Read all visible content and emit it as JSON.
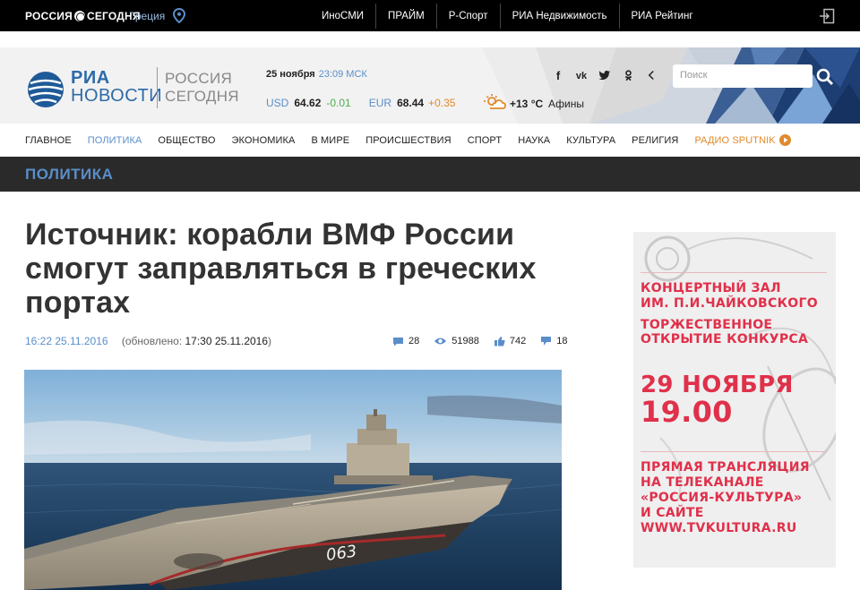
{
  "topbar": {
    "logo": "РОССИЯ СЕГОДНЯ",
    "logo_left": "РОССИЯ",
    "logo_right": "СЕГОДНЯ",
    "region": "Греция",
    "links": [
      "ИноСМИ",
      "ПРАЙМ",
      "Р-Спорт",
      "РИА Недвижимость",
      "РИА Рейтинг"
    ]
  },
  "header": {
    "logo_ria": "РИА",
    "logo_novosti": "НОВОСТИ",
    "logo_rossiya": "РОССИЯ",
    "logo_segodnya": "СЕГОДНЯ",
    "date": "25 ноября",
    "time": "23:09 МСК",
    "usd_label": "USD",
    "usd_value": "64.62",
    "usd_change": "-0.01",
    "eur_label": "EUR",
    "eur_value": "68.44",
    "eur_change": "+0.35",
    "temperature": "+13 °C",
    "city": "Афины",
    "search_placeholder": "Поиск",
    "social": [
      "f",
      "vk",
      "twitter",
      "ok",
      "share"
    ]
  },
  "nav": {
    "items": [
      "ГЛАВНОЕ",
      "ПОЛИТИКА",
      "ОБЩЕСТВО",
      "ЭКОНОМИКА",
      "В МИРЕ",
      "ПРОИСШЕСТВИЯ",
      "СПОРТ",
      "НАУКА",
      "КУЛЬТУРА",
      "РЕЛИГИЯ"
    ],
    "active": "ПОЛИТИКА",
    "radio": "РАДИО SPUTNIK"
  },
  "section": {
    "title": "ПОЛИТИКА"
  },
  "article": {
    "headline": "Источник: корабли ВМФ России смогут заправляться в греческих портах",
    "time": "16:22",
    "date": "25.11.2016",
    "updated_label": "(обновлено:",
    "updated_value": "17:30 25.11.2016",
    "updated_close": ")",
    "comments": "28",
    "views": "51988",
    "likes": "742",
    "reposts": "18",
    "ship_number": "063"
  },
  "ad": {
    "line1": "КОНЦЕРТНЫЙ ЗАЛ",
    "line2": "ИМ. П.И.ЧАЙКОВСКОГО",
    "line3": "ТОРЖЕСТВЕННОЕ",
    "line4": "ОТКРЫТИЕ КОНКУРСА",
    "date": "29 НОЯБРЯ",
    "hour": "19.00",
    "line7": "ПРЯМАЯ ТРАНСЛЯЦИЯ",
    "line8": "НА ТЕЛЕКАНАЛЕ",
    "line9": "«РОССИЯ-КУЛЬТУРА»",
    "line10": "И САЙТЕ",
    "line11": "WWW.TVKULTURA.RU"
  },
  "colors": {
    "accent_blue": "#5a8ec9",
    "accent_orange": "#e08a2c",
    "ad_red": "#e0304a",
    "topbar": "#000000",
    "section_bar": "#2a2a2a"
  }
}
